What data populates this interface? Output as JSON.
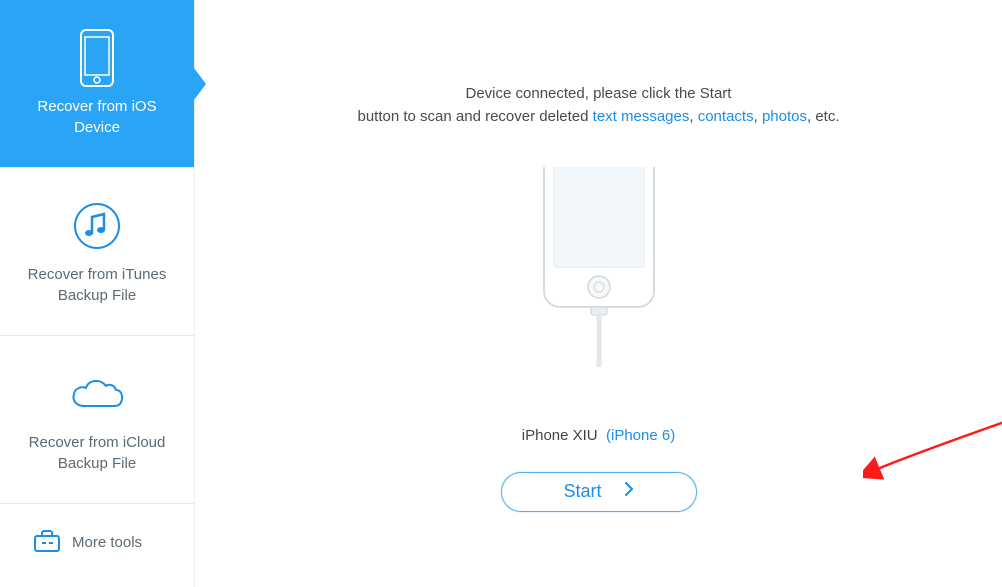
{
  "sidebar": {
    "items": [
      {
        "label": "Recover from iOS Device",
        "icon": "phone-icon",
        "active": true
      },
      {
        "label": "Recover from iTunes Backup File",
        "icon": "music-disc-icon",
        "active": false
      },
      {
        "label": "Recover from iCloud Backup File",
        "icon": "cloud-icon",
        "active": false
      }
    ],
    "more_label": "More tools"
  },
  "main": {
    "instruction_line1": "Device connected, please click the Start",
    "instruction_line2_pre": "button to scan and recover deleted ",
    "instruction_link1": "text messages",
    "instruction_sep1": ", ",
    "instruction_link2": "contacts",
    "instruction_sep2": ", ",
    "instruction_link3": "photos",
    "instruction_line2_post": ", etc.",
    "device_name": "iPhone XIU",
    "device_model": "(iPhone 6)",
    "start_label": "Start"
  },
  "colors": {
    "accent": "#2aa4f4",
    "link": "#1a8fe8"
  }
}
